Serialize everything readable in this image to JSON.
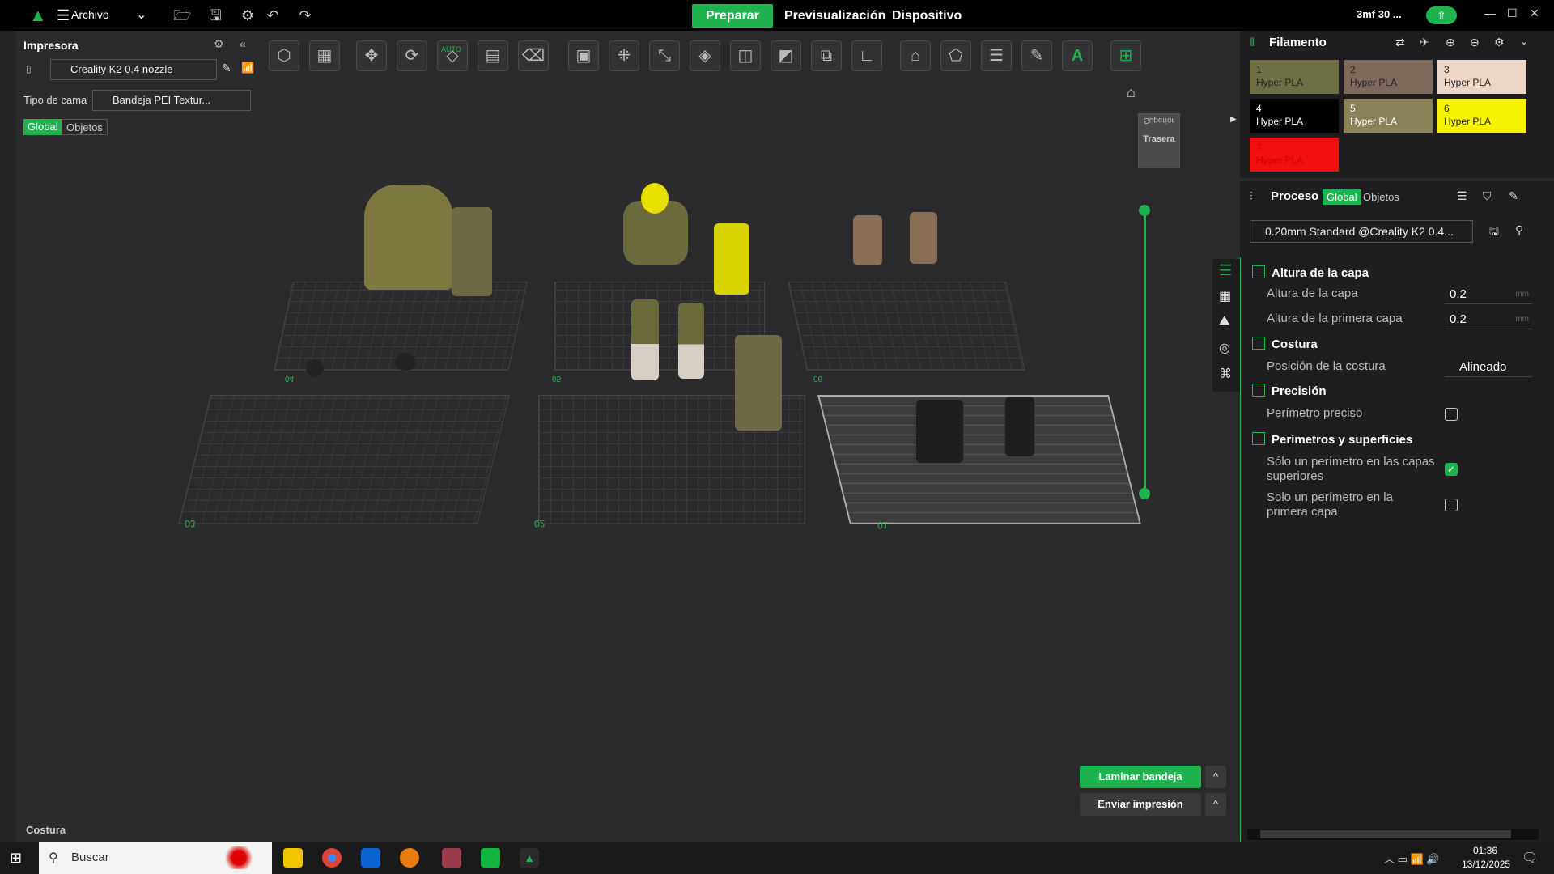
{
  "titlebar": {
    "menu_label": "Archivo",
    "tabs": [
      "Preparar",
      "Previsualización",
      "Dispositivo"
    ],
    "project_name": "3mf 30 ..."
  },
  "printer_panel": {
    "title": "Impresora",
    "printer_name": "Creality K2 0.4 nozzle",
    "bed_label": "Tipo de cama",
    "bed_value": "Bandeja PEI Textur...",
    "toggle_global": "Global",
    "toggle_objects": "Objetos"
  },
  "toolbar": {
    "auto_label": "AUTO"
  },
  "view_cube": {
    "top_label": "Superior",
    "back_label": "Trasera"
  },
  "plates": [
    {
      "label": "04"
    },
    {
      "label": "05"
    },
    {
      "label": "06"
    },
    {
      "label": "03"
    },
    {
      "label": "02"
    },
    {
      "label": "01"
    }
  ],
  "filament": {
    "title": "Filamento",
    "slots": [
      {
        "num": "1",
        "name": "Hyper PLA",
        "color": "#6f6f46"
      },
      {
        "num": "2",
        "name": "Hyper PLA",
        "color": "#7e6a5a"
      },
      {
        "num": "3",
        "name": "Hyper PLA",
        "color": "#ecd6c8"
      },
      {
        "num": "4",
        "name": "Hyper PLA",
        "color": "#000000"
      },
      {
        "num": "5",
        "name": "Hyper PLA",
        "color": "#8a8259"
      },
      {
        "num": "6",
        "name": "Hyper PLA",
        "color": "#f7f300"
      },
      {
        "num": "7",
        "name": "Hyper PLA",
        "color": "#ef0f0f"
      }
    ]
  },
  "process": {
    "title": "Proceso",
    "toggle_global": "Global",
    "toggle_objects": "Objetos",
    "profile": "0.20mm Standard @Creality K2 0.4...",
    "sections": {
      "layer_height": "Altura de la capa",
      "seam": "Costura",
      "precision": "Precisión",
      "walls": "Perímetros y superficies"
    },
    "rows": {
      "layer_height_label": "Altura de la capa",
      "layer_height_value": "0.2",
      "first_layer_label": "Altura de la primera capa",
      "first_layer_value": "0.2",
      "unit": "mm",
      "seam_pos_label": "Posición de la costura",
      "seam_pos_value": "Alineado",
      "precise_wall_label": "Perímetro preciso",
      "only_one_top_label": "Sólo un perímetro en las capas superiores",
      "only_one_first_label": "Solo un perímetro en la primera capa"
    }
  },
  "actions": {
    "slice": "Laminar bandeja",
    "print": "Enviar impresión",
    "caret": "^"
  },
  "bottom_left": "Costura",
  "taskbar": {
    "search": "Buscar",
    "time": "01:36",
    "date": "13/12/2025"
  },
  "colors": {
    "accent": "#1fb34f",
    "background": "#2b2b2d",
    "panel": "#1e1e20"
  }
}
